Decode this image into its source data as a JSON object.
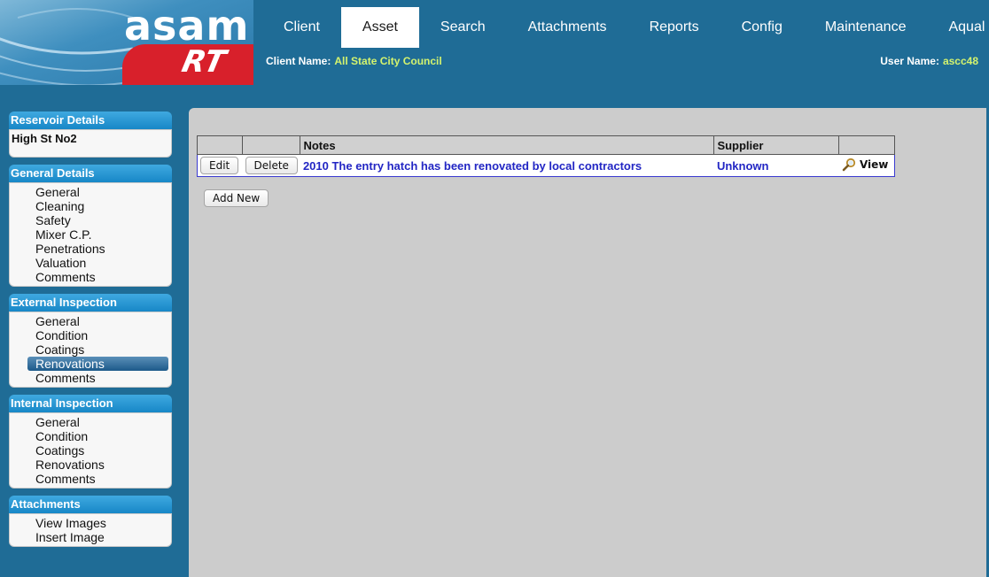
{
  "logo": {
    "wordmark": "asam",
    "sub": "RT"
  },
  "colors": {
    "header_bg": "#1f6c96",
    "link": "#2226c4",
    "accent_text": "#d4f36e",
    "panel_header": "#1787c7"
  },
  "nav": {
    "tabs": [
      {
        "label": "Client"
      },
      {
        "label": "Asset",
        "active": true
      },
      {
        "label": "Search"
      },
      {
        "label": "Attachments"
      },
      {
        "label": "Reports"
      },
      {
        "label": "Config"
      },
      {
        "label": "Maintenance"
      },
      {
        "label": "Aqual"
      }
    ]
  },
  "header": {
    "client_label": "Client Name:",
    "client_value": "All State City Council",
    "user_label": "User Name:",
    "user_value": "ascc48"
  },
  "sidebar": {
    "reservoir": {
      "title": "Reservoir Details",
      "value": "High St No2"
    },
    "general": {
      "title": "General Details",
      "items": [
        "General",
        "Cleaning",
        "Safety",
        "Mixer C.P.",
        "Penetrations",
        "Valuation",
        "Comments"
      ]
    },
    "external": {
      "title": "External Inspection",
      "items": [
        "General",
        "Condition",
        "Coatings",
        "Renovations",
        "Comments"
      ],
      "selected": "Renovations"
    },
    "internal": {
      "title": "Internal Inspection",
      "items": [
        "General",
        "Condition",
        "Coatings",
        "Renovations",
        "Comments"
      ]
    },
    "attachments": {
      "title": "Attachments",
      "items": [
        "View Images",
        "Insert Image"
      ]
    }
  },
  "table": {
    "columns": [
      "",
      "",
      "Notes",
      "Supplier",
      ""
    ],
    "rows": [
      {
        "edit": "Edit",
        "delete": "Delete",
        "note": "2010 The entry hatch has been renovated by local contractors",
        "supplier": "Unknown",
        "view": "View",
        "view_icon": "magnifier-icon"
      }
    ]
  },
  "add_new_label": "Add New"
}
